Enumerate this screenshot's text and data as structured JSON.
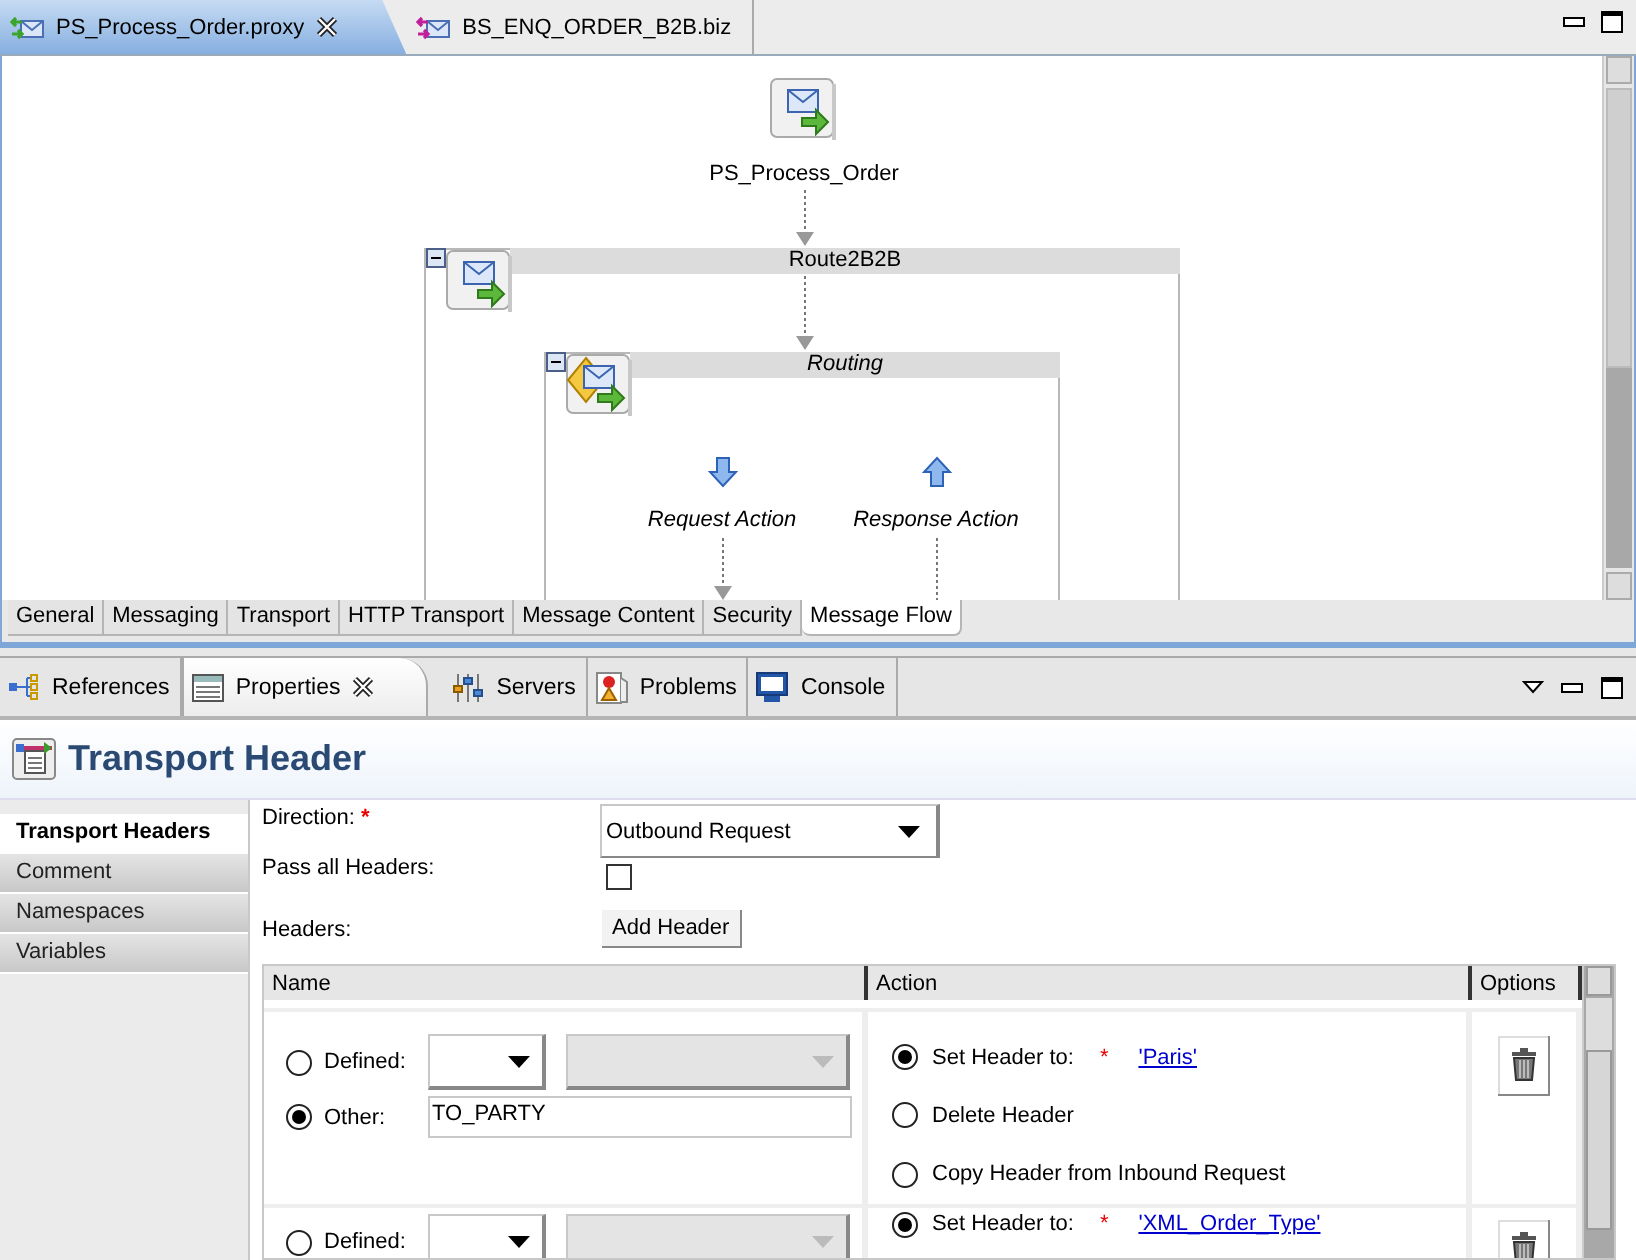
{
  "editor_tabs": [
    {
      "label": "PS_Process_Order.proxy",
      "selected": true,
      "closable": true
    },
    {
      "label": "BS_ENQ_ORDER_B2B.biz",
      "selected": false,
      "closable": false
    }
  ],
  "flow": {
    "start": {
      "label": "PS_Process_Order"
    },
    "pipeline": {
      "label": "Route2B2B"
    },
    "route": {
      "label": "Routing"
    },
    "actions": [
      {
        "label": "Request Action",
        "kind": "request"
      },
      {
        "label": "Response Action",
        "kind": "response"
      }
    ]
  },
  "editor_pages": [
    {
      "label": "General",
      "selected": false
    },
    {
      "label": "Messaging",
      "selected": false
    },
    {
      "label": "Transport",
      "selected": false
    },
    {
      "label": "HTTP Transport",
      "selected": false
    },
    {
      "label": "Message Content",
      "selected": false
    },
    {
      "label": "Security",
      "selected": false
    },
    {
      "label": "Message Flow",
      "selected": true
    }
  ],
  "views": [
    {
      "label": "References",
      "selected": false,
      "closable": false
    },
    {
      "label": "Properties",
      "selected": true,
      "closable": true
    },
    {
      "label": "Servers",
      "selected": false,
      "closable": false
    },
    {
      "label": "Problems",
      "selected": false,
      "closable": false
    },
    {
      "label": "Console",
      "selected": false,
      "closable": false
    }
  ],
  "properties": {
    "title": "Transport Header",
    "sections": [
      {
        "label": "Transport Headers",
        "selected": true
      },
      {
        "label": "Comment",
        "selected": false
      },
      {
        "label": "Namespaces",
        "selected": false
      },
      {
        "label": "Variables",
        "selected": false
      }
    ],
    "direction_label": "Direction:",
    "required_mark": "*",
    "direction": "Outbound Request",
    "pass_all_label": "Pass all Headers:",
    "pass_all": false,
    "headers_label": "Headers:",
    "add_button": "Add Header",
    "columns": [
      "Name",
      "Action",
      "Options"
    ],
    "rows": [
      {
        "name_options": [
          {
            "kind": "defined",
            "label": "Defined:",
            "selected": false
          },
          {
            "kind": "other",
            "label": "Other:",
            "selected": true,
            "value": "TO_PARTY"
          }
        ],
        "actions": [
          {
            "label": "Set Header to:",
            "selected": true,
            "required": "*",
            "value": "'Paris'"
          },
          {
            "label": "Delete Header",
            "selected": false
          },
          {
            "label": "Copy Header from Inbound Request",
            "selected": false
          }
        ]
      },
      {
        "name_options": [
          {
            "kind": "defined",
            "label": "Defined:",
            "selected": false
          }
        ],
        "actions": [
          {
            "label": "Set Header to:",
            "selected": true,
            "required": "*",
            "value": "'XML_Order_Type'"
          }
        ]
      }
    ]
  }
}
